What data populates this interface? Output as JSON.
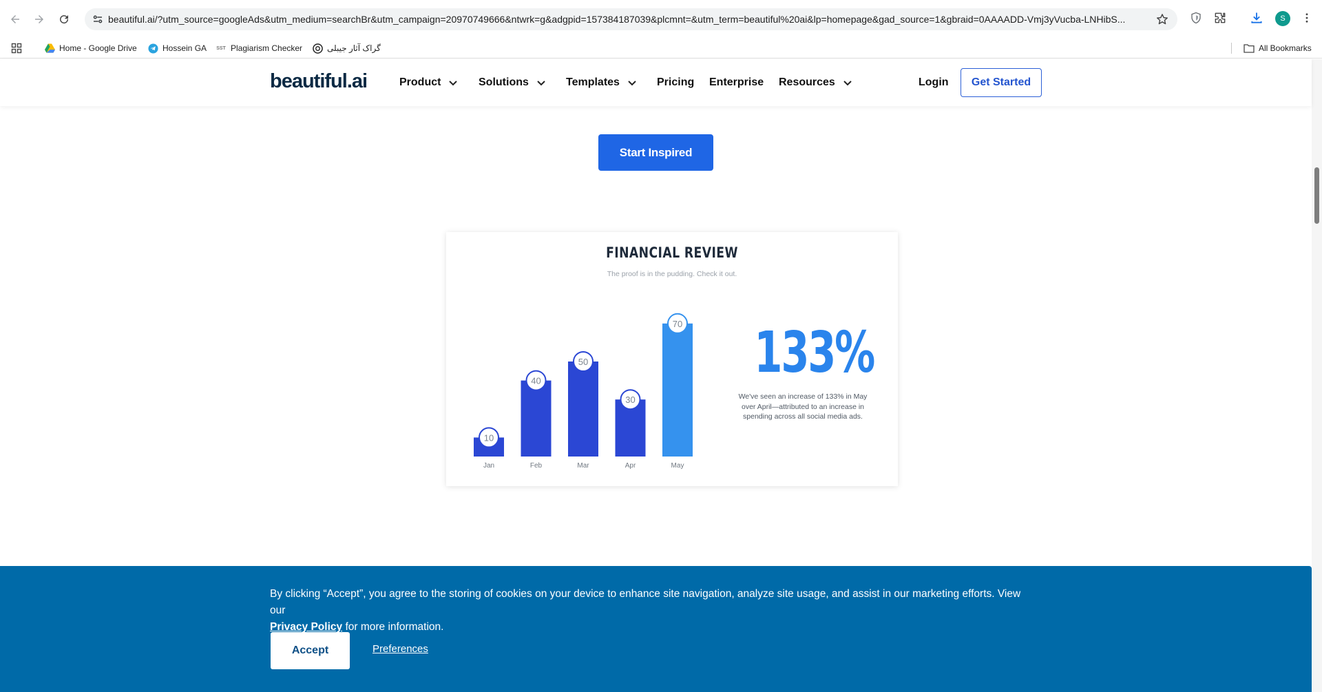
{
  "browser": {
    "url": "beautiful.ai/?utm_source=googleAds&utm_medium=searchBr&utm_campaign=20970749666&ntwrk=g&adgpid=157384187039&plcmnt=&utm_term=beautiful%20ai&lp=homepage&gad_source=1&gbraid=0AAAADD-Vmj3yVucba-LNHibS...",
    "profile_initial": "S",
    "icons": {
      "back": "back-arrow-icon",
      "forward": "forward-arrow-icon",
      "reload": "reload-icon",
      "site_info": "tune-icon",
      "bookmark": "star-icon",
      "shield": "shield-icon",
      "extensions": "puzzle-icon",
      "downloads": "download-icon",
      "menu": "kebab-menu-icon"
    }
  },
  "bookmarks": {
    "items": [
      {
        "label": "Home - Google Drive",
        "icon": "google-drive-icon"
      },
      {
        "label": "Hossein GA",
        "icon": "telegram-icon"
      },
      {
        "label": "Plagiarism Checker",
        "icon": "sst-icon"
      },
      {
        "label": "گراک آثار جیبلی",
        "icon": "openai-icon"
      }
    ],
    "all_label": "All Bookmarks"
  },
  "header": {
    "logo": "beautiful.ai",
    "nav": [
      {
        "label": "Product",
        "has_menu": true
      },
      {
        "label": "Solutions",
        "has_menu": true
      },
      {
        "label": "Templates",
        "has_menu": true
      },
      {
        "label": "Pricing",
        "has_menu": false
      },
      {
        "label": "Enterprise",
        "has_menu": false
      },
      {
        "label": "Resources",
        "has_menu": true
      }
    ],
    "login": "Login",
    "get_started": "Get Started"
  },
  "hero": {
    "cta": "Start Inspired"
  },
  "slide": {
    "title": "FINANCIAL REVIEW",
    "subtitle": "The proof is in the pudding. Check it out.",
    "stat": "133%",
    "stat_desc": "We've seen an increase of 133% in May over April—attributed to an increase in spending across all social media ads."
  },
  "chart_data": {
    "type": "bar",
    "categories": [
      "Jan",
      "Feb",
      "Mar",
      "Apr",
      "May"
    ],
    "values": [
      10,
      40,
      50,
      30,
      70
    ],
    "ylim": [
      0,
      75
    ],
    "grid": false,
    "colors": [
      "#2b47d4",
      "#2b47d4",
      "#2b47d4",
      "#2b47d4",
      "#3592ee"
    ]
  },
  "cookie": {
    "text": "By clicking “Accept”, you agree to the storing of cookies on your device to enhance site navigation, analyze site usage, and assist in our marketing efforts. View our",
    "privacy": "Privacy Policy",
    "text_after": "for more information.",
    "accept": "Accept",
    "preferences": "Preferences"
  },
  "colors": {
    "brand": "#1f66e5",
    "cookie_bg": "#006aa8",
    "logo": "#0c2a44"
  }
}
